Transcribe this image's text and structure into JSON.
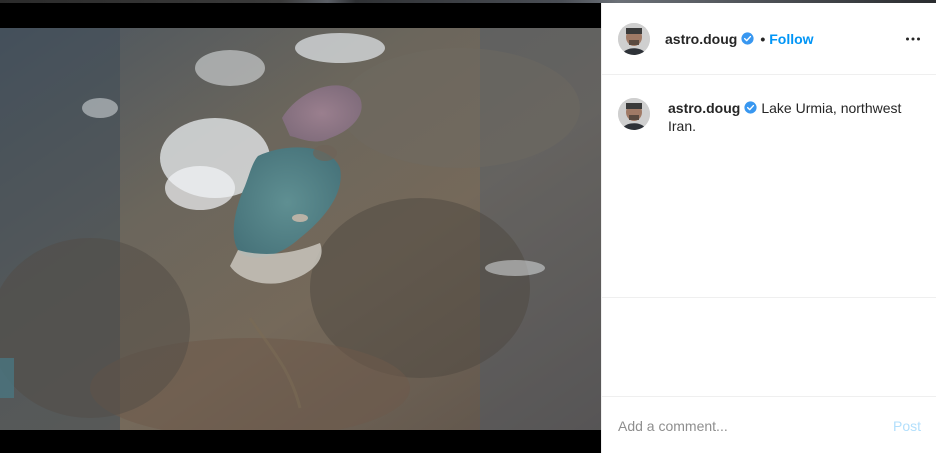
{
  "post": {
    "username": "astro.doug",
    "follow_label": "Follow",
    "separator": "•",
    "caption_line1": "Lake Urmia, northwest",
    "caption_line2": "Iran."
  },
  "comment": {
    "placeholder": "Add a comment...",
    "post_label": "Post"
  },
  "colors": {
    "accent": "#0095f6",
    "post_disabled": "#b2dffc",
    "text": "#262626",
    "verified": "#3897f0"
  },
  "icons": {
    "verified": "verified-badge-icon",
    "more": "more-options-icon"
  }
}
